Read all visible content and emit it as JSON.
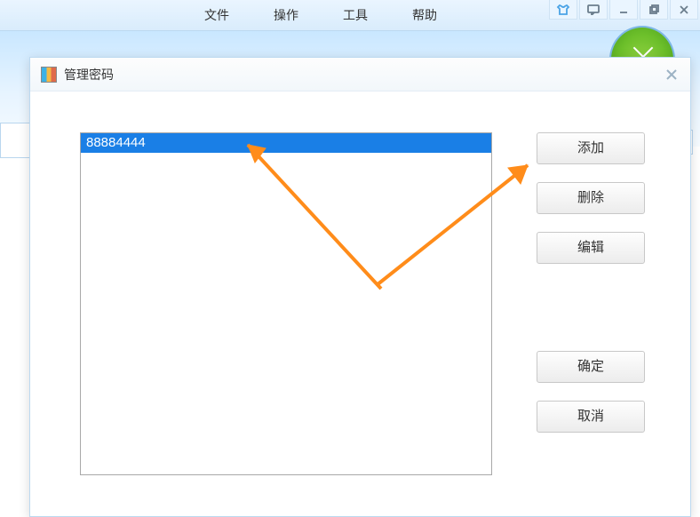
{
  "menu": {
    "file": "文件",
    "operate": "操作",
    "tools": "工具",
    "help": "帮助"
  },
  "dialog": {
    "title": "管理密码",
    "list": {
      "item0": "88884444"
    },
    "buttons": {
      "add": "添加",
      "delete": "删除",
      "edit": "编辑",
      "ok": "确定",
      "cancel": "取消"
    }
  }
}
